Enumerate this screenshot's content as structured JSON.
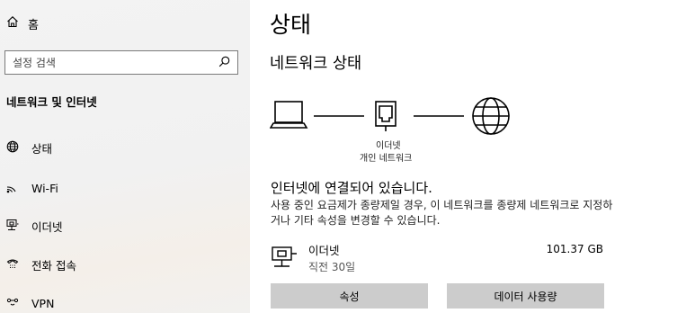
{
  "sidebar": {
    "home_label": "홈",
    "search_placeholder": "설정 검색",
    "section_title": "네트워크 및 인터넷",
    "items": [
      {
        "label": "상태",
        "icon": "globe-icon"
      },
      {
        "label": "Wi-Fi",
        "icon": "wifi-icon"
      },
      {
        "label": "이더넷",
        "icon": "ethernet-icon"
      },
      {
        "label": "전화 접속",
        "icon": "dialup-icon"
      },
      {
        "label": "VPN",
        "icon": "vpn-icon"
      }
    ]
  },
  "main": {
    "page_title": "상태",
    "section_title": "네트워크 상태",
    "diagram": {
      "adapter_label": "이더넷",
      "network_label": "개인 네트워크"
    },
    "status_heading": "인터넷에 연결되어 있습니다.",
    "status_description": "사용 중인 요금제가 종량제일 경우, 이 네트워크를 종량제 네트워크로 지정하거나 기타 속성을 변경할 수 있습니다.",
    "connection": {
      "name": "이더넷",
      "time": "직전 30일",
      "usage": "101.37 GB"
    },
    "buttons": {
      "properties": "속성",
      "data_usage": "데이터 사용량"
    }
  }
}
